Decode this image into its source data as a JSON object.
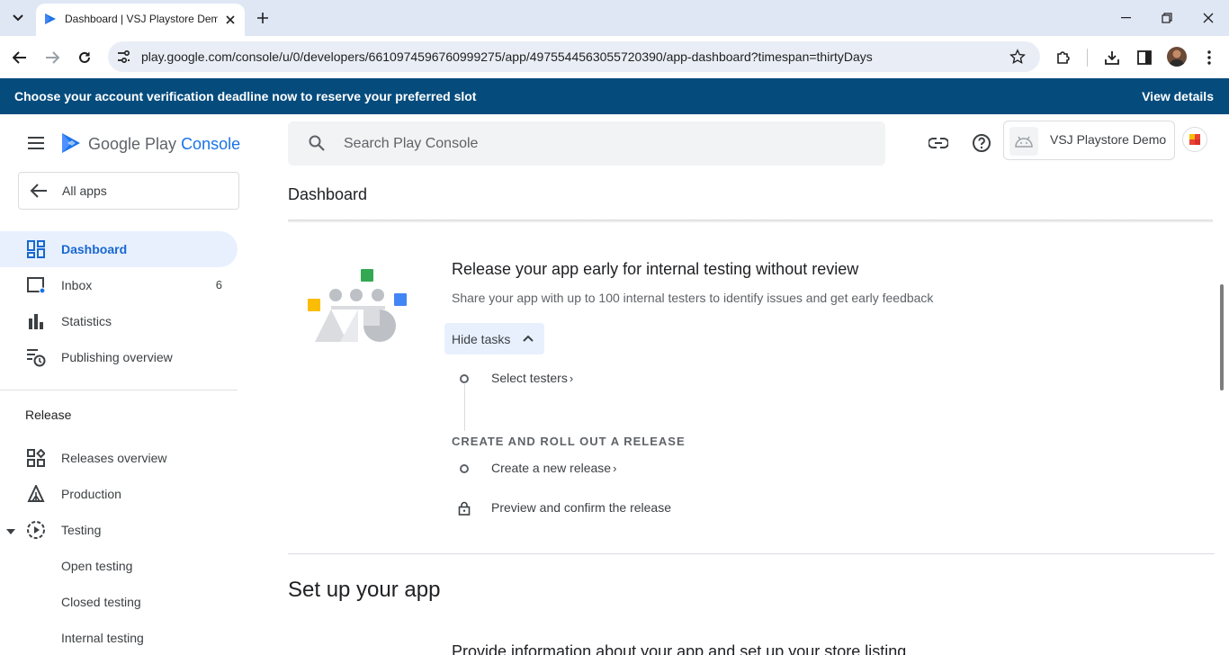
{
  "browser": {
    "tab_title": "Dashboard | VSJ Playstore Demo",
    "url": "play.google.com/console/u/0/developers/6610974596760999275/app/4975544563055720390/app-dashboard?timespan=thirtyDays"
  },
  "banner": {
    "text": "Choose your account verification deadline now to reserve your preferred slot",
    "link": "View details",
    "background": "#054c7d"
  },
  "header": {
    "logo_text_a": "Google Play ",
    "logo_text_b": "Console",
    "search_placeholder": "Search Play Console",
    "developer_name": "VSJ Playstore Demo"
  },
  "sidebar": {
    "all_apps": "All apps",
    "items": [
      {
        "label": "Dashboard",
        "icon": "dashboard-icon",
        "active": true
      },
      {
        "label": "Inbox",
        "icon": "inbox-icon",
        "count": "6"
      },
      {
        "label": "Statistics",
        "icon": "bar-chart-icon"
      },
      {
        "label": "Publishing overview",
        "icon": "publishing-icon"
      }
    ],
    "release_section": "Release",
    "release_items": [
      {
        "label": "Releases overview",
        "icon": "releases-icon"
      },
      {
        "label": "Production",
        "icon": "production-icon"
      },
      {
        "label": "Testing",
        "icon": "testing-icon"
      },
      {
        "label": "Open testing"
      },
      {
        "label": "Closed testing"
      },
      {
        "label": "Internal testing"
      }
    ]
  },
  "main": {
    "page_title": "Dashboard",
    "card": {
      "title": "Release your app early for internal testing without review",
      "subtitle": "Share your app with up to 100 internal testers to identify issues and get early feedback",
      "hide_tasks": "Hide tasks",
      "task_select_testers": "Select testers",
      "group_heading": "CREATE AND ROLL OUT A RELEASE",
      "task_create_release": "Create a new release",
      "task_preview": "Preview and confirm the release"
    },
    "setup_title": "Set up your app",
    "setup_subtitle": "Provide information about your app and set up your store listing"
  },
  "colors": {
    "accent": "#1a73e8",
    "active_nav_bg": "#e8f0fe"
  }
}
